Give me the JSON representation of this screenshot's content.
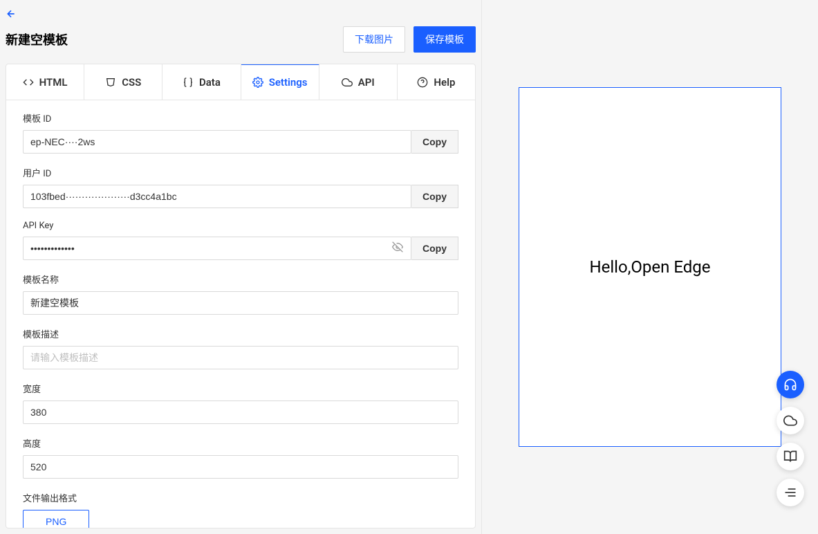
{
  "header": {
    "title": "新建空模板",
    "download_button": "下载图片",
    "save_button": "保存模板"
  },
  "tabs": {
    "html": "HTML",
    "css": "CSS",
    "data": "Data",
    "settings": "Settings",
    "api": "API",
    "help": "Help"
  },
  "fields": {
    "template_id": {
      "label": "模板 ID",
      "value": "ep-NEC····2ws",
      "copy": "Copy"
    },
    "user_id": {
      "label": "用户 ID",
      "value": "103fbed····················d3cc4a1bc",
      "copy": "Copy"
    },
    "api_key": {
      "label": "API Key",
      "value": "•••••••••••••",
      "copy": "Copy"
    },
    "template_name": {
      "label": "模板名称",
      "value": "新建空模板"
    },
    "template_desc": {
      "label": "模板描述",
      "placeholder": "请输入模板描述"
    },
    "width": {
      "label": "宽度",
      "value": "380"
    },
    "height": {
      "label": "高度",
      "value": "520"
    },
    "output_format": {
      "label": "文件输出格式",
      "value": "PNG"
    }
  },
  "preview": {
    "text": "Hello,Open Edge"
  }
}
